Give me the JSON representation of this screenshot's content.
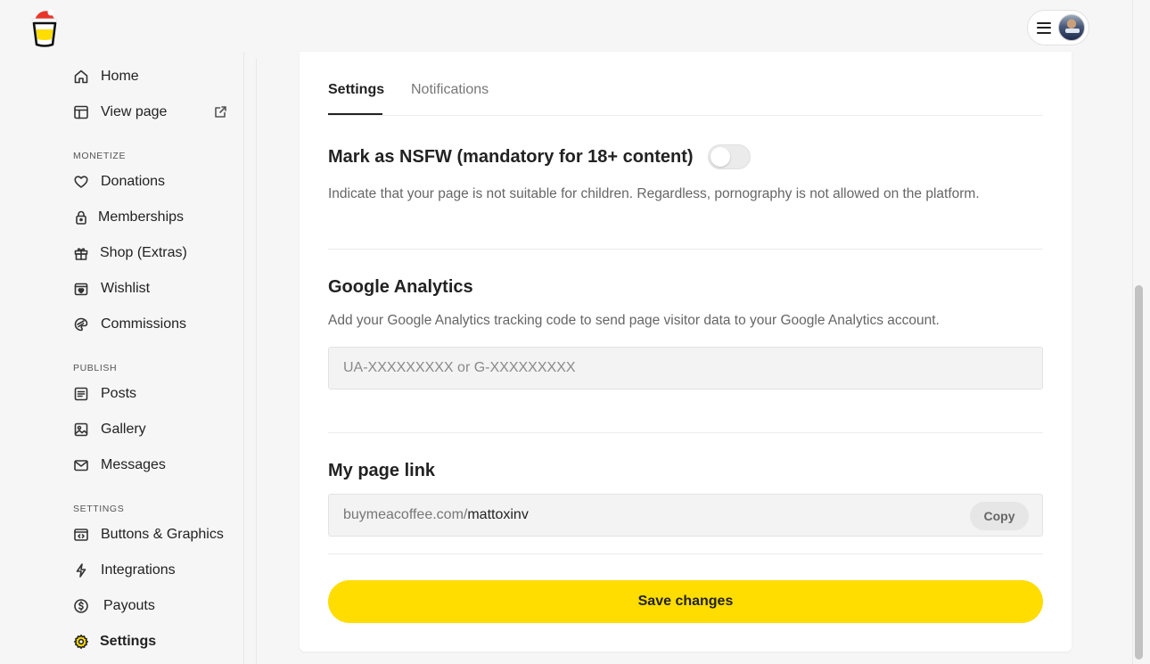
{
  "header": {
    "logo_icon": "coffee-cup-santa-hat-icon",
    "menu_icon": "hamburger-icon",
    "avatar_icon": "user-avatar"
  },
  "sidebar": {
    "items": [
      {
        "label": "Home",
        "icon": "home-icon"
      },
      {
        "label": "View page",
        "icon": "layout-icon"
      }
    ],
    "sections": [
      {
        "title": "MONETIZE",
        "items": [
          {
            "label": "Donations",
            "icon": "heart-icon"
          },
          {
            "label": "Memberships",
            "icon": "lock-icon"
          },
          {
            "label": "Shop (Extras)",
            "icon": "gift-icon"
          },
          {
            "label": "Wishlist",
            "icon": "wishlist-icon"
          },
          {
            "label": "Commissions",
            "icon": "palette-icon"
          }
        ]
      },
      {
        "title": "PUBLISH",
        "items": [
          {
            "label": "Posts",
            "icon": "document-icon"
          },
          {
            "label": "Gallery",
            "icon": "image-icon"
          },
          {
            "label": "Messages",
            "icon": "mail-icon"
          }
        ]
      },
      {
        "title": "SETTINGS",
        "items": [
          {
            "label": "Buttons & Graphics",
            "icon": "code-window-icon"
          },
          {
            "label": "Integrations",
            "icon": "lightning-icon"
          },
          {
            "label": "Payouts",
            "icon": "dollar-icon"
          },
          {
            "label": "Settings",
            "icon": "gear-icon"
          }
        ]
      }
    ]
  },
  "tabs": [
    {
      "label": "Settings",
      "active": true
    },
    {
      "label": "Notifications",
      "active": false
    }
  ],
  "nsfw": {
    "title": "Mark as NSFW (mandatory for 18+ content)",
    "description": "Indicate that your page is not suitable for children. Regardless, pornography is not allowed on the platform.",
    "enabled": false
  },
  "analytics": {
    "title": "Google Analytics",
    "description": "Add your Google Analytics tracking code to send page visitor data to your Google Analytics account.",
    "placeholder": "UA-XXXXXXXXX or G-XXXXXXXXX",
    "value": ""
  },
  "page_link": {
    "title": "My page link",
    "prefix": "buymeacoffee.com/",
    "handle": "mattoxinv",
    "copy_label": "Copy"
  },
  "save_label": "Save changes",
  "colors": {
    "accent": "#ffdd00",
    "background": "#f6f6f6"
  }
}
